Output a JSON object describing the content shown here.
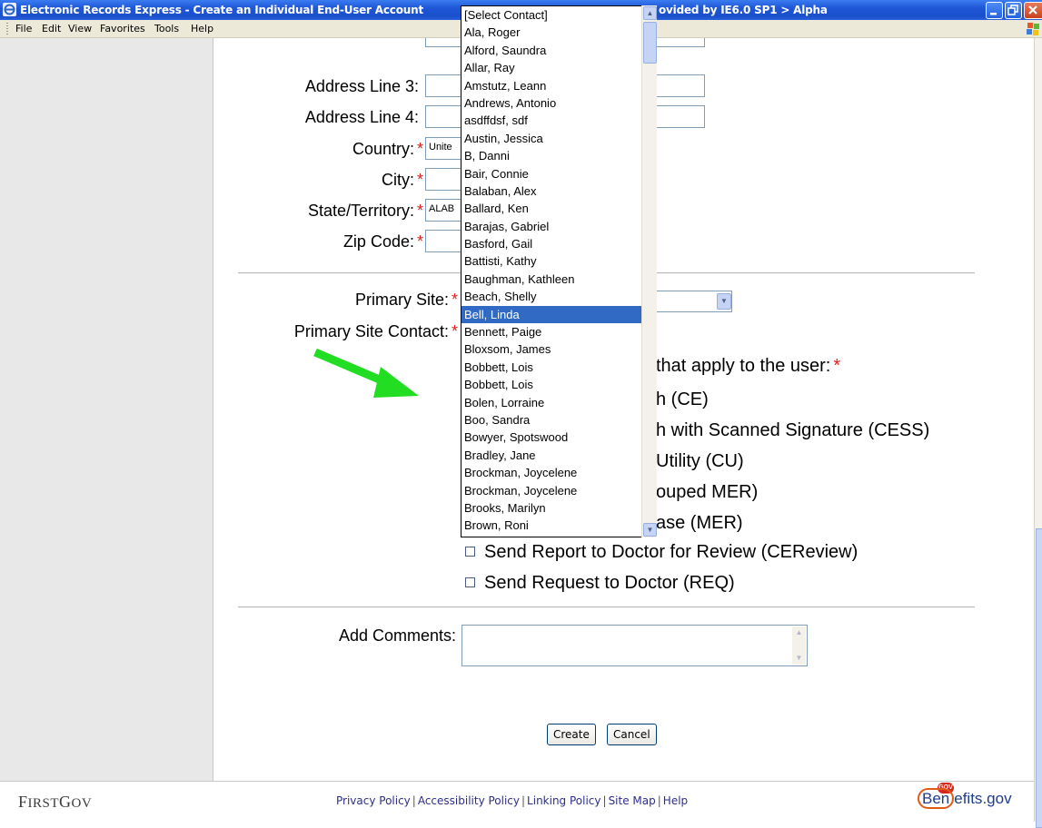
{
  "window": {
    "title_left": "Electronic Records Express - Create an Individual End-User Account",
    "title_right": "ovided by IE6.0 SP1 > Alpha"
  },
  "menubar": [
    "File",
    "Edit",
    "View",
    "Favorites",
    "Tools",
    "Help"
  ],
  "form": {
    "address_line3_label": "Address Line 3:",
    "address_line4_label": "Address Line 4:",
    "country_label": "Country:",
    "country_value": "Unite",
    "city_label": "City:",
    "state_label": "State/Territory:",
    "state_value": "ALAB",
    "zip_label": "Zip Code:",
    "primary_site_label": "Primary Site:",
    "primary_site_contact_label": "Primary Site Contact:",
    "required_mark": "*",
    "applies_text": "that apply to the user:",
    "checkbox_partials": [
      "h (CE)",
      "h with Scanned Signature (CESS)",
      "Utility (CU)",
      "ouped MER)",
      "ase (MER)"
    ],
    "cereview_label": "Send Report to Doctor for Review (CEReview)",
    "req_label": "Send Request to Doctor (REQ)",
    "comments_label": "Add Comments:",
    "create_button": "Create",
    "cancel_button": "Cancel"
  },
  "contact_dropdown": {
    "selected": "Bell, Linda",
    "options": [
      "[Select Contact]",
      "Ala, Roger",
      "Alford, Saundra",
      "Allar, Ray",
      "Amstutz, Leann",
      "Andrews, Antonio",
      "asdffdsf, sdf",
      "Austin, Jessica",
      "B, Danni",
      "Bair, Connie",
      "Balaban, Alex",
      "Ballard, Ken",
      "Barajas, Gabriel",
      "Basford, Gail",
      "Battisti, Kathy",
      "Baughman, Kathleen",
      "Beach, Shelly",
      "Bell, Linda",
      "Bennett, Paige",
      "Bloxsom, James",
      "Bobbett, Lois",
      "Bobbett, Lois",
      "Bolen, Lorraine",
      "Boo, Sandra",
      "Bowyer, Spotswood",
      "Bradley, Jane",
      "Brockman, Joycelene",
      "Brockman, Joycelene",
      "Brooks, Marilyn",
      "Brown, Roni"
    ]
  },
  "footer": {
    "firstgov_first": "F",
    "firstgov_rest1": "IRST",
    "firstgov_g": "G",
    "firstgov_rest2": "OV",
    "links": [
      "Privacy Policy",
      "Accessibility Policy",
      "Linking Policy",
      "Site Map",
      "Help"
    ],
    "link_separator": "|",
    "benefits_logo_b": "Ben",
    "benefits_logo_rest": "efits",
    "benefits_logo_dot": ".gov",
    "gov_badge": "GOV"
  },
  "colors": {
    "selection": "#316ac5",
    "required": "#e02020",
    "arrow": "#22dd22",
    "link": "#2b2e8c"
  }
}
